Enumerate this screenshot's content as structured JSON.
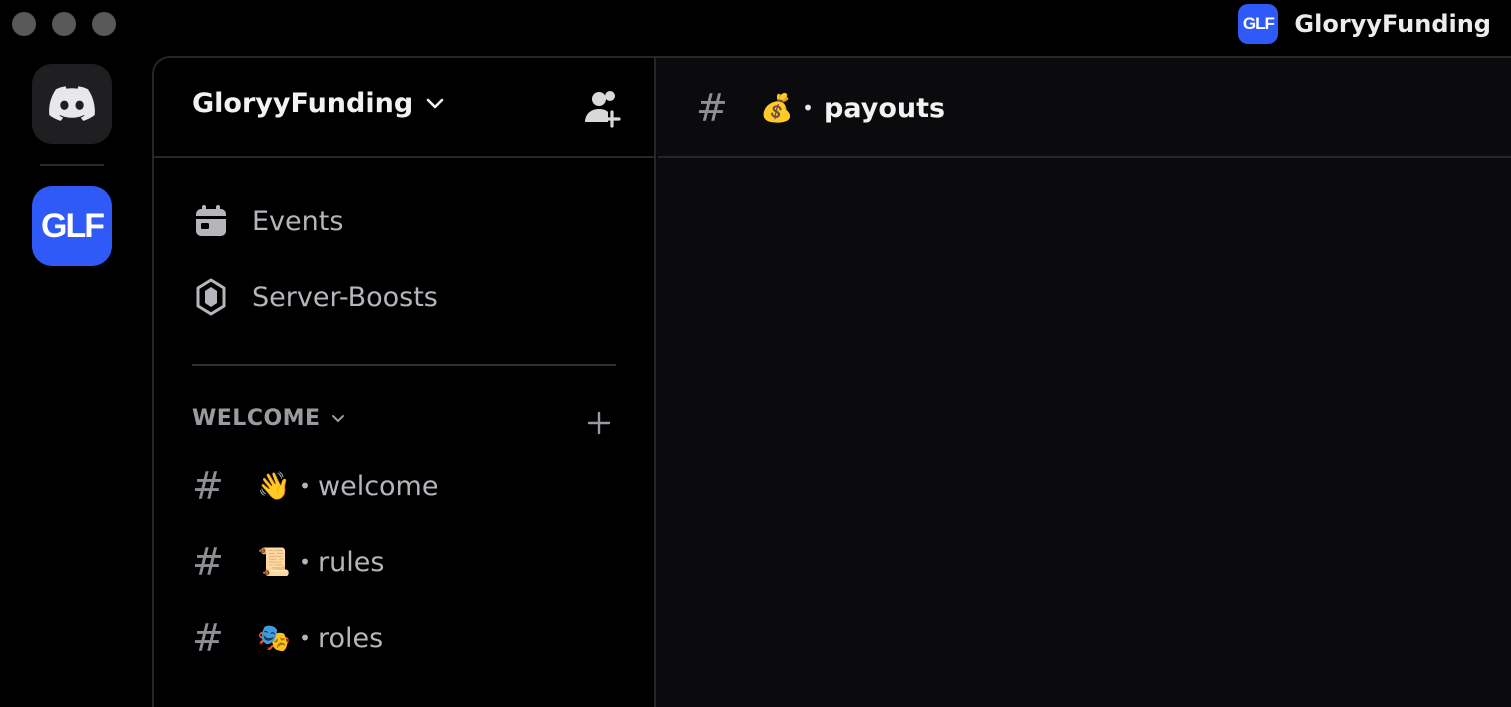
{
  "window": {
    "traffic_lights": [
      "close",
      "minimize",
      "zoom"
    ],
    "server_logo_text": "GLF",
    "server_name": "GloryyFunding"
  },
  "rail": {
    "home_icon": "discord-logo-icon",
    "server_logo_text": "GLF"
  },
  "sidebar": {
    "server_name": "GloryyFunding",
    "dropdown_icon": "chevron-down-icon",
    "invite_icon": "add-member-icon",
    "nav": [
      {
        "label": "Events",
        "icon": "calendar-icon"
      },
      {
        "label": "Server-Boosts",
        "icon": "boost-gem-icon"
      }
    ],
    "category": {
      "label": "WELCOME",
      "add_icon": "plus-icon"
    },
    "channels": [
      {
        "hash": "#",
        "emoji": "👋",
        "sep": "•",
        "name": "welcome"
      },
      {
        "hash": "#",
        "emoji": "📜",
        "sep": "•",
        "name": "rules"
      },
      {
        "hash": "#",
        "emoji": "🎭",
        "sep": "•",
        "name": "roles"
      }
    ]
  },
  "content": {
    "channel": {
      "hash": "#",
      "emoji": "💰",
      "sep": "•",
      "name": "payouts"
    }
  },
  "colors": {
    "accent": "#2f5af7",
    "background": "#000000",
    "content_bg": "#0b0b0d",
    "muted_text": "#b5b6bb"
  }
}
